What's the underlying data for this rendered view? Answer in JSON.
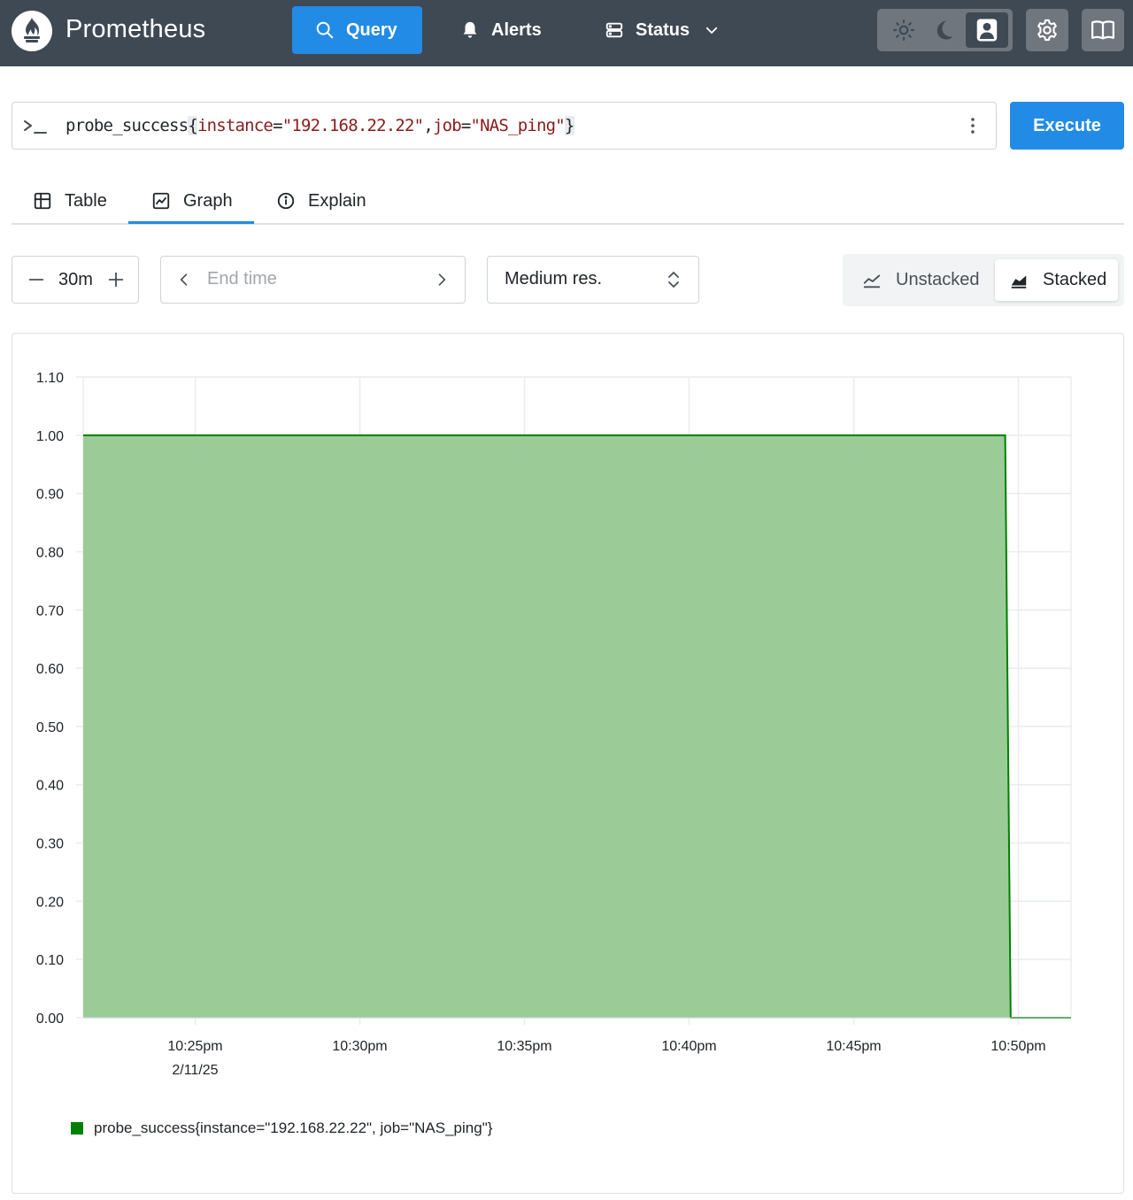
{
  "header": {
    "app_title": "Prometheus",
    "nav": {
      "query": "Query",
      "alerts": "Alerts",
      "status": "Status"
    }
  },
  "query": {
    "metric": "probe_success",
    "open_brace": "{",
    "label1_name": "instance",
    "label1_op": "=",
    "label1_value": "\"192.168.22.22\"",
    "comma": ",",
    "label2_name": "job",
    "label2_op": "=",
    "label2_value": "\"NAS_ping\"",
    "close_brace": "}",
    "execute_label": "Execute"
  },
  "tabs": {
    "table": "Table",
    "graph": "Graph",
    "explain": "Explain",
    "active": "graph"
  },
  "controls": {
    "range": "30m",
    "end_time_placeholder": "End time",
    "resolution": "Medium res.",
    "unstacked": "Unstacked",
    "stacked": "Stacked",
    "active_mode": "stacked"
  },
  "colors": {
    "header_bg": "#3f4954",
    "accent": "#228be6",
    "series_line": "#008000",
    "series_fill": "#9bcc98"
  },
  "chart_data": {
    "type": "area",
    "stacked": true,
    "ylim": [
      0,
      1.1
    ],
    "y_ticks": [
      "0.00",
      "0.10",
      "0.20",
      "0.30",
      "0.40",
      "0.50",
      "0.60",
      "0.70",
      "0.80",
      "0.90",
      "1.00",
      "1.10"
    ],
    "x_ticks": [
      {
        "label": "10:25pm",
        "sublabel": "2/11/25"
      },
      {
        "label": "10:30pm",
        "sublabel": ""
      },
      {
        "label": "10:35pm",
        "sublabel": ""
      },
      {
        "label": "10:40pm",
        "sublabel": ""
      },
      {
        "label": "10:45pm",
        "sublabel": ""
      },
      {
        "label": "10:50pm",
        "sublabel": ""
      }
    ],
    "x_range_minutes": [
      "10:21:36pm",
      "10:51:36pm"
    ],
    "grid": true,
    "legend_position": "bottom-left",
    "series": [
      {
        "name": "probe_success{instance=\"192.168.22.22\", job=\"NAS_ping\"}",
        "points": [
          {
            "x": "10:21:36pm",
            "y": 1
          },
          {
            "x": "10:49:36pm",
            "y": 1
          },
          {
            "x": "10:49:46pm",
            "y": 0
          },
          {
            "x": "10:51:36pm",
            "y": 0
          }
        ]
      }
    ]
  }
}
